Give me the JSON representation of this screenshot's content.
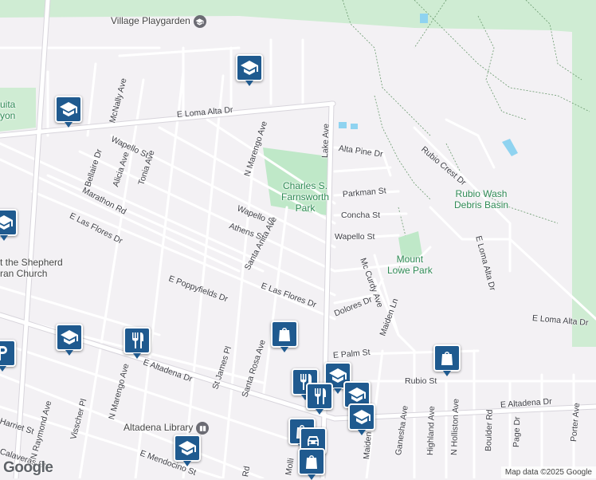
{
  "map": {
    "colors": {
      "land": "#f3f1f4",
      "road": "#ffffff",
      "road_outline": "#d8d5dc",
      "major_road": "#ffffff",
      "park": "#bfe8c8",
      "forest": "#cfecd3",
      "water": "#8fd3f0",
      "trail": "#6a9a6e",
      "marker": "#1f5a8f"
    },
    "attribution": "Map data ©2025 Google",
    "logo": "Google"
  },
  "places": {
    "village_playgarden": "Village Playgarden",
    "charles_farnsworth_park": [
      "Charles S.",
      "Farnsworth",
      "Park"
    ],
    "rubio_wash": [
      "Rubio Wash",
      "Debris Basin"
    ],
    "mount_lowe_park": [
      "Mount",
      "Lowe Park"
    ],
    "shepherd_church": [
      "t the Shepherd",
      "ran Church"
    ],
    "canyon_partial": [
      "uita",
      "yon"
    ],
    "altadena_library": "Altadena Library",
    "right_edge_partial": "uita"
  },
  "streets": {
    "e_loma_alta_dr": "E Loma Alta Dr",
    "mcnally_ave": "McNally Ave",
    "n_marengo_ave": "N Marengo Ave",
    "lake_ave": "Lake Ave",
    "alta_pine_dr": "Alta Pine Dr",
    "rubio_crest_dr": "Rubio Crest Dr",
    "wapello_st_w": "Wapello St",
    "bellaire_dr": "Bellaire Dr",
    "alicia_ave": "Alicia Ave",
    "tonia_ave": "Tonia Ave",
    "marathon_rd": "Marathon Rd",
    "parkman_st": "Parkman St",
    "concha_st": "Concha St",
    "wapello_st_e": "Wapello St",
    "wapello_st_mid": "Wapello St",
    "athens_st": "Athens St",
    "e_las_flores_dr_w": "E Las Flores Dr",
    "santa_anita_ave": "Santa Anita Ave",
    "e_loma_alta_dr_vertical": "E Loma Alta Dr",
    "mc_curdy_ave": "Mc Curdy Ave",
    "e_poppyfields_dr": "E Poppyfields Dr",
    "e_las_flores_dr_e": "E Las Flores Dr",
    "dolores_dr": "Dolores Dr",
    "maiden_ln": "Maiden Ln",
    "e_loma_alta_dr_e": "E Loma Alta Dr",
    "e_altadena_dr_w": "E Altadena Dr",
    "st_james_pl": "St James Pl",
    "santa_rosa_ave": "Santa Rosa Ave",
    "e_palm_st": "E Palm St",
    "rubio_st": "Rubio St",
    "n_marengo_ave_s": "N Marengo Ave",
    "e_altadena_dr_e": "E Altadena Dr",
    "porter_ave": "Porter Ave",
    "harriet_st": "Harriet St",
    "n_raymond_ave": "N Raymond Ave",
    "visscher_pl": "Visscher Pl",
    "ganesha_ave": "Ganesha Ave",
    "highland_ave": "Highland Ave",
    "n_holliston_ave": "N Holliston Ave",
    "boulder_rd": "Boulder Rd",
    "page_dr": "Page Dr",
    "calaveras_st": "Calaveras St",
    "e_mendocino_st": "E Mendocino St",
    "maiden_ln_s": "Maiden Ln",
    "mollino": "Molli",
    "rd_partial": "Rd",
    "e_partial": "E",
    "alta_partial": "Alta",
    "st_partial": "St",
    "f_partial": "F"
  },
  "markers": [
    {
      "id": "school-1",
      "icon": "graduation-cap-icon"
    },
    {
      "id": "school-2",
      "icon": "graduation-cap-icon"
    },
    {
      "id": "school-3",
      "icon": "graduation-cap-icon"
    },
    {
      "id": "school-4",
      "icon": "graduation-cap-icon"
    },
    {
      "id": "school-5",
      "icon": "graduation-cap-icon"
    },
    {
      "id": "school-6",
      "icon": "graduation-cap-icon"
    },
    {
      "id": "school-7",
      "icon": "graduation-cap-icon"
    },
    {
      "id": "restaurant-1",
      "icon": "fork-knife-icon"
    },
    {
      "id": "restaurant-2",
      "icon": "fork-knife-icon"
    },
    {
      "id": "restaurant-3",
      "icon": "fork-knife-icon"
    },
    {
      "id": "shop-1",
      "icon": "shopping-bag-icon"
    },
    {
      "id": "shop-2",
      "icon": "shopping-bag-icon"
    },
    {
      "id": "shop-3",
      "icon": "shopping-bag-icon"
    },
    {
      "id": "shop-4",
      "icon": "shopping-bag-icon"
    },
    {
      "id": "parking-1",
      "icon": "parking-icon"
    },
    {
      "id": "car-1",
      "icon": "car-icon"
    }
  ]
}
